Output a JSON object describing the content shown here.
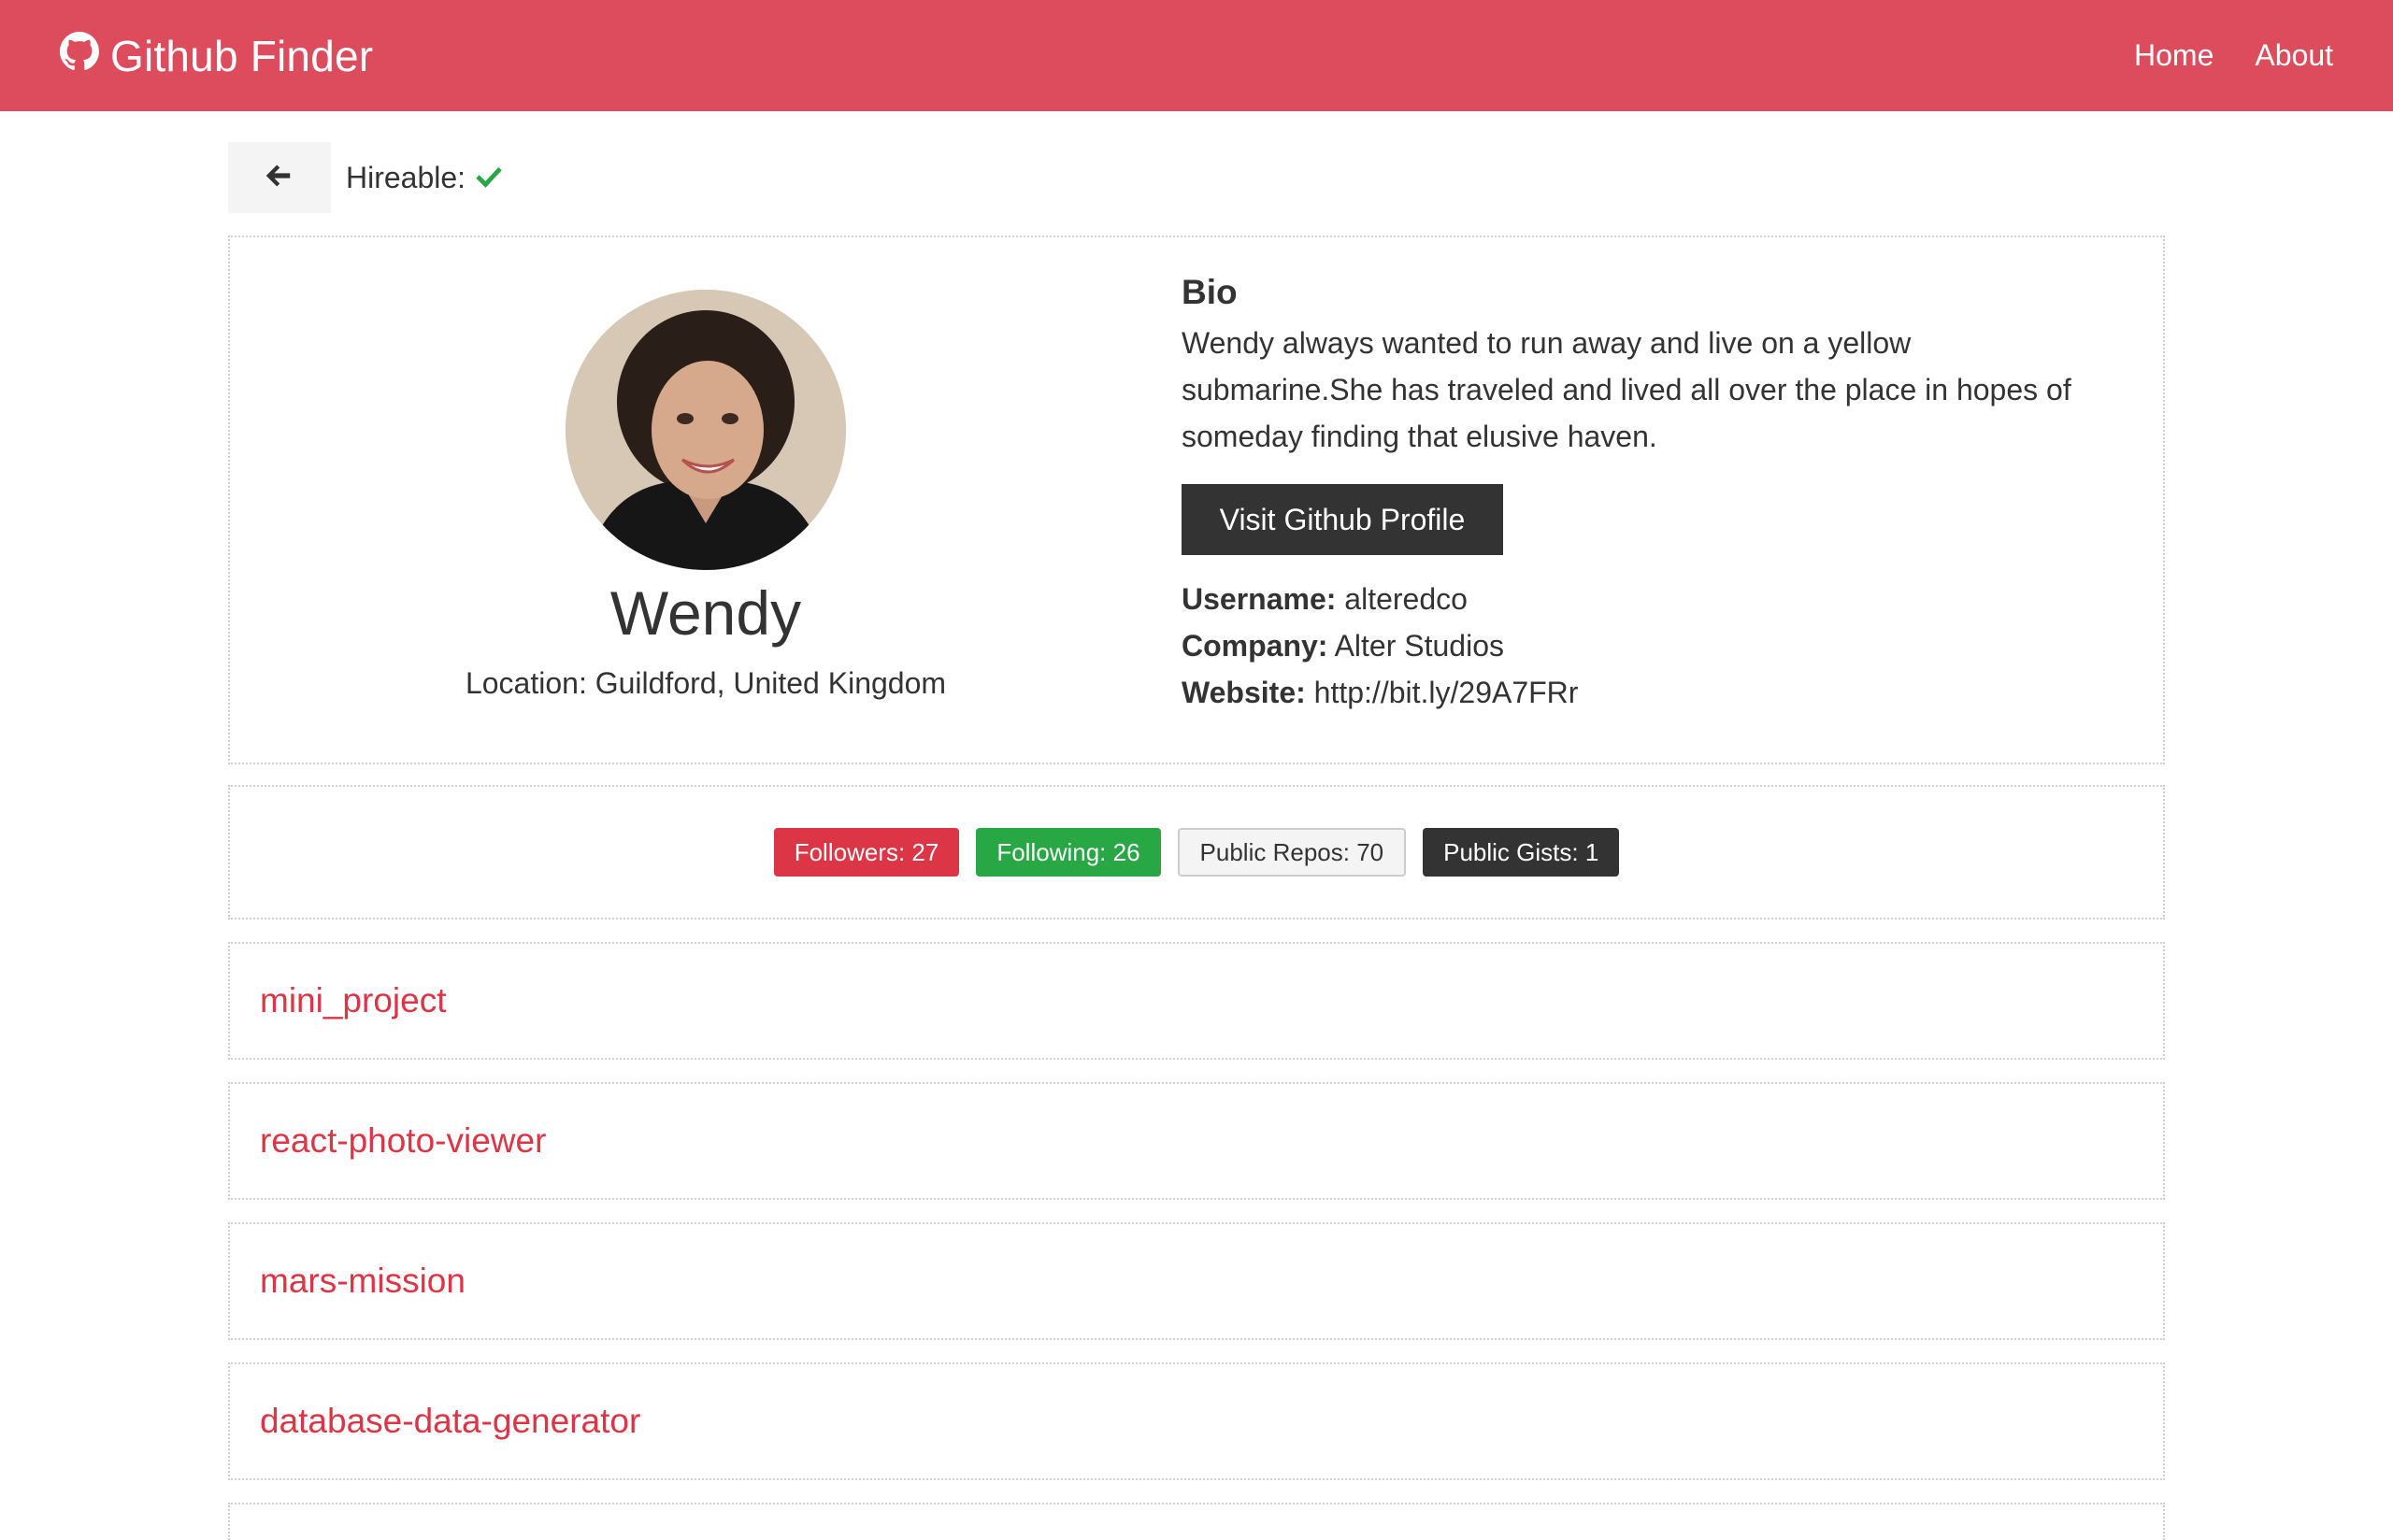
{
  "navbar": {
    "brand": "Github Finder",
    "links": [
      "Home",
      "About"
    ]
  },
  "top": {
    "hireable_label": "Hireable:"
  },
  "profile": {
    "name": "Wendy",
    "location": "Location: Guildford, United Kingdom",
    "bio_title": "Bio",
    "bio": "Wendy always wanted to run away and live on a yellow submarine.She has traveled and lived all over the place in hopes of someday finding that elusive haven.",
    "visit_button": "Visit Github Profile",
    "username_label": "Username:",
    "username": "alteredco",
    "company_label": "Company:",
    "company": "Alter Studios",
    "website_label": "Website:",
    "website": "http://bit.ly/29A7FRr"
  },
  "stats": {
    "followers": "Followers: 27",
    "following": "Following: 26",
    "public_repos": "Public Repos: 70",
    "public_gists": "Public Gists: 1"
  },
  "repos": [
    "mini_project",
    "react-photo-viewer",
    "mars-mission",
    "database-data-generator"
  ],
  "colors": {
    "navbar": "#dc4c5c",
    "primary": "#dc3545",
    "success": "#28a745",
    "dark": "#333333",
    "light": "#f4f4f4"
  },
  "icons": {
    "brand": "github-icon",
    "back": "arrow-left-icon",
    "hireable": "check-icon"
  }
}
